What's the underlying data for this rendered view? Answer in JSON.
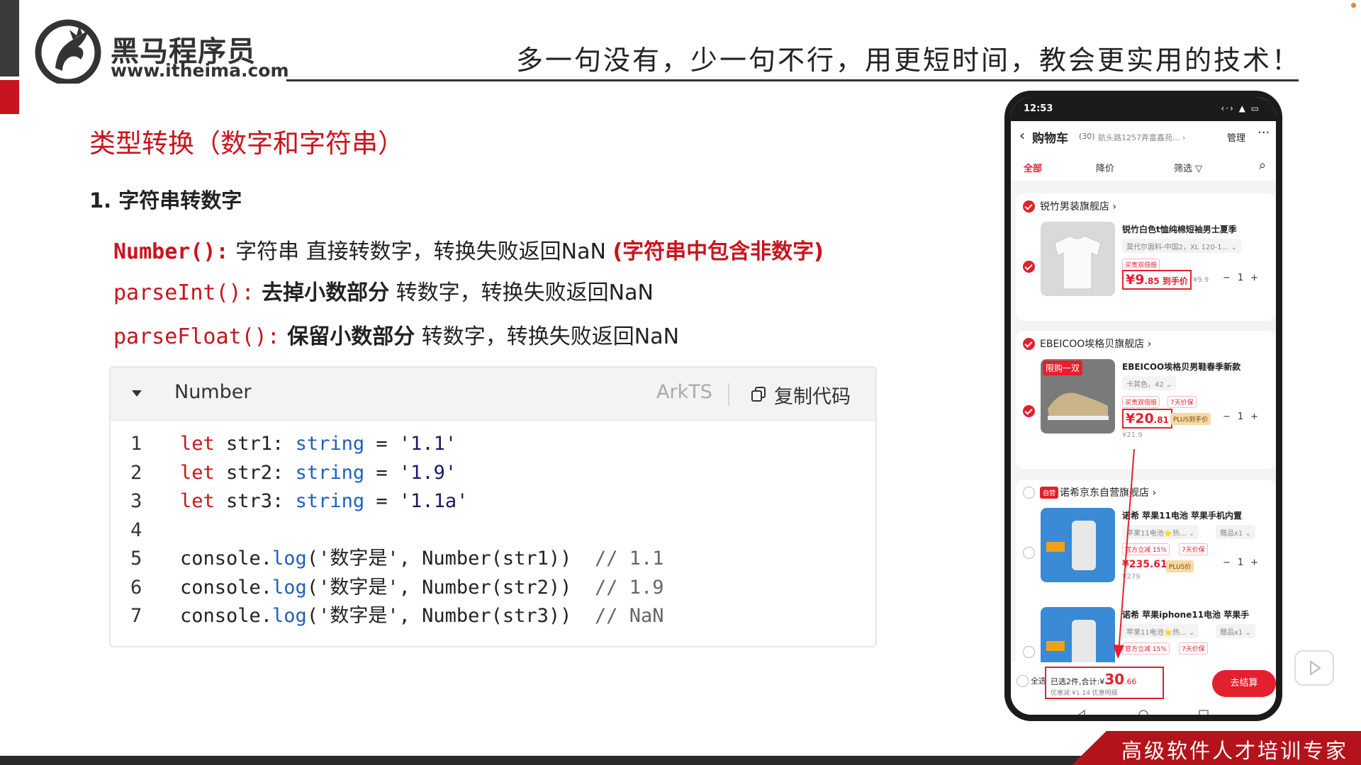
{
  "header": {
    "logo_cn": "黑马程序员",
    "logo_url": "www.itheima.com",
    "slogan": "多一句没有，少一句不行，用更短时间，教会更实用的技术！"
  },
  "slide": {
    "title": "类型转换（数字和字符串）",
    "section": "1. 字符串转数字",
    "rules": [
      {
        "fn": "Number():",
        "desc": " 字符串 直接转数字，转换失败返回NaN ",
        "note": "(字符串中包含非数字)"
      },
      {
        "fn": "parseInt():",
        "bold": " 去掉小数部分",
        "desc": " 转数字，转换失败返回NaN"
      },
      {
        "fn": "parseFloat():",
        "bold": " 保留小数部分",
        "desc": " 转数字，转换失败返回NaN"
      }
    ]
  },
  "code_block": {
    "title": "Number",
    "language": "ArkTS",
    "copy_label": "复制代码",
    "lines": [
      {
        "n": "1",
        "kw": "let",
        "var": " str1: ",
        "type": "string",
        "rest": " = ",
        "str": "'1.1'"
      },
      {
        "n": "2",
        "kw": "let",
        "var": " str2: ",
        "type": "string",
        "rest": " = ",
        "str": "'1.9'"
      },
      {
        "n": "3",
        "kw": "let",
        "var": " str3: ",
        "type": "string",
        "rest": " = ",
        "str": "'1.1a'"
      },
      {
        "n": "4"
      },
      {
        "n": "5",
        "obj": "console.",
        "fn": "log",
        "args": "('数字是', Number(str1))",
        "comment": "  // 1.1"
      },
      {
        "n": "6",
        "obj": "console.",
        "fn": "log",
        "args": "('数字是', Number(str2))",
        "comment": "  // 1.9"
      },
      {
        "n": "7",
        "obj": "console.",
        "fn": "log",
        "args": "('数字是', Number(str3))",
        "comment": "  // NaN"
      }
    ]
  },
  "phone": {
    "time": "12:53",
    "status_icons": "‹·› ▲ ▭",
    "nav": {
      "back": "‹",
      "title": "购物车",
      "count": "(30)",
      "address": "航头路1257弄富鑫苑... ›",
      "manage": "管理",
      "more": "···"
    },
    "tabs": {
      "all": "全部",
      "price_drop": "降价",
      "filter": "筛选 ▽",
      "search": "⌕"
    },
    "stores": [
      {
        "name": "锐竹男装旗舰店 ›",
        "checked": true,
        "product": "锐竹白色t恤纯棉短袖男士夏季",
        "spec": "莫代尔面料-中国2，XL 120-1... ⌄",
        "tags": [
          "买贵双倍赔"
        ],
        "price_int": "¥9",
        "price_dec": ".85 到手价",
        "orig": "¥9.9",
        "qty": "−1+"
      },
      {
        "name": "EBEICOO埃格贝旗舰店 ›",
        "checked": true,
        "product": "EBEICOO埃格贝男鞋春季新款",
        "spec": "卡其色，42 ⌄",
        "tags": [
          "买贵双倍赔",
          "7天价保"
        ],
        "badge": "限购一双",
        "price_int": "¥20",
        "price_dec": ".81",
        "plus": "PLUS到手价",
        "orig": "¥21.9",
        "qty": "−1+"
      },
      {
        "name": "诺希京东自营旗舰店 ›",
        "self_tag": "自营",
        "checked": false,
        "product": "诺希 苹果11电池 苹果手机内置",
        "spec": "苹果11电池⭐热... ⌄",
        "gift": "赠品x1 ⌄",
        "tags": [
          "官方立减 15%",
          "7天价保"
        ],
        "price": "¥235.61",
        "plus": "PLUS价",
        "orig": "¥279",
        "qty": "−1+",
        "product2": "诺希 苹果iphone11电池 苹果手",
        "spec2": "苹果11电池⭐热... ⌄",
        "gift2": "赠品x1 ⌄",
        "tags2": [
          "官方立减 15%",
          "7天价保"
        ]
      }
    ],
    "footer": {
      "select_all": "全选",
      "total_prefix": "已选2件,合计:¥",
      "total_int": "30",
      "total_dec": ".66",
      "discount": "优惠减:¥1.14  优惠明细",
      "checkout": "去结算"
    }
  },
  "footer": {
    "tagline": "高级软件人才培训专家"
  },
  "colors": {
    "accent_red": "#c8141e",
    "phone_red": "#e3202e",
    "keyword": "#c8141e",
    "type_blue": "#1f5fbf"
  }
}
